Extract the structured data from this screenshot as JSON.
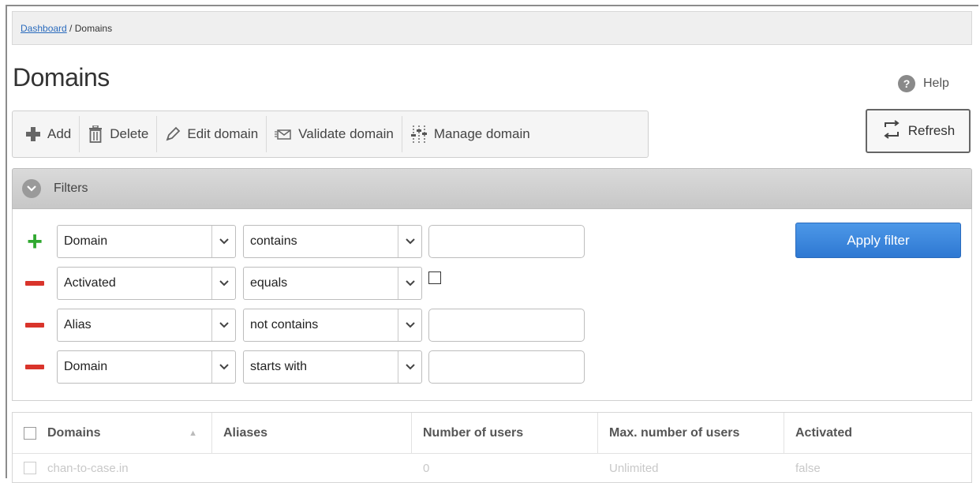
{
  "breadcrumb": {
    "link": "Dashboard",
    "separator": " / ",
    "current": "Domains"
  },
  "page": {
    "title": "Domains",
    "help_label": "Help",
    "help_icon": "question-circle-icon"
  },
  "toolbar": {
    "add_label": "Add",
    "delete_label": "Delete",
    "edit_label": "Edit domain",
    "validate_label": "Validate domain",
    "manage_label": "Manage domain",
    "refresh_label": "Refresh"
  },
  "filters": {
    "title": "Filters",
    "apply_label": "Apply filter",
    "rows": [
      {
        "sign": "add",
        "field": "Domain",
        "operator": "contains",
        "value": ""
      },
      {
        "sign": "remove",
        "field": "Activated",
        "operator": "equals",
        "checkbox": false
      },
      {
        "sign": "remove",
        "field": "Alias",
        "operator": "not contains",
        "value": ""
      },
      {
        "sign": "remove",
        "field": "Domain",
        "operator": "starts with",
        "value": ""
      }
    ]
  },
  "table": {
    "columns": [
      "Domains",
      "Aliases",
      "Number of users",
      "Max. number of users",
      "Activated"
    ],
    "rows": [
      {
        "domain": "chan-to-case.in",
        "aliases": "",
        "users": "0",
        "max_users": "Unlimited",
        "activated": "false"
      }
    ]
  },
  "colors": {
    "apply_button": "#2e78d2",
    "add_sign": "#2fa82f",
    "remove_sign": "#d9342b",
    "link": "#2a6bbd"
  }
}
